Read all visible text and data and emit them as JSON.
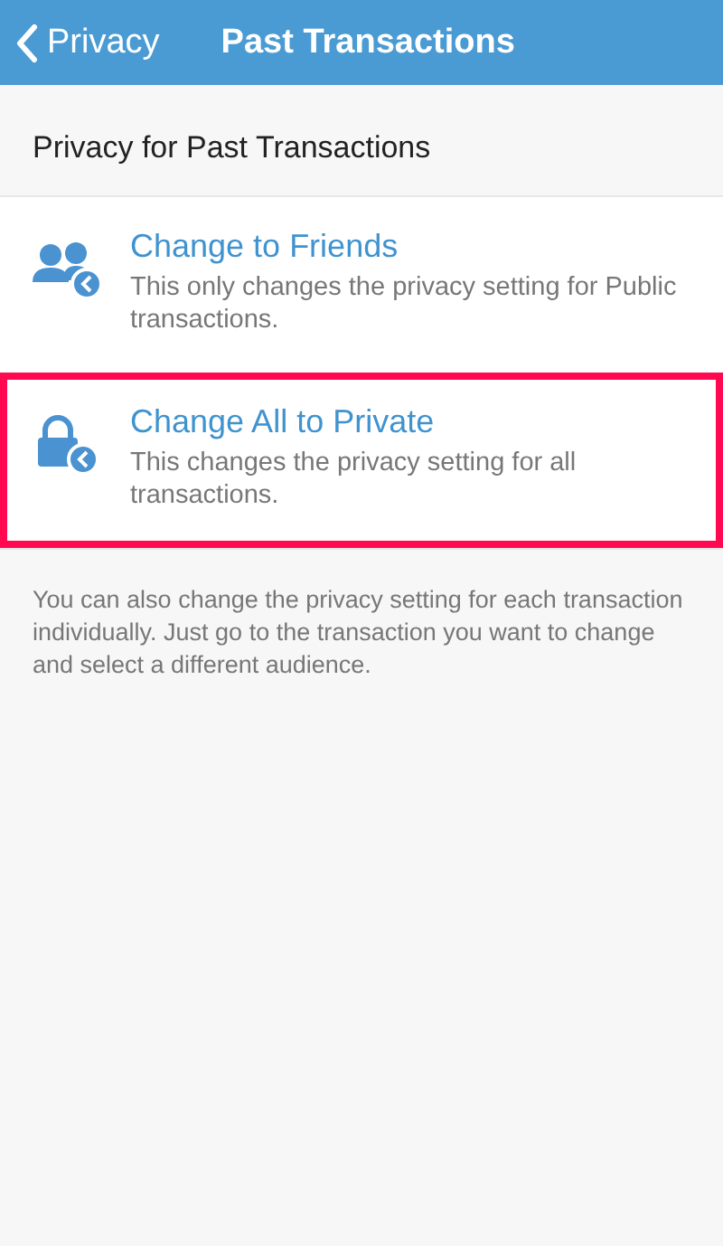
{
  "nav_bar": {
    "back_label": "Privacy",
    "title": "Past Transactions"
  },
  "section": {
    "title": "Privacy for Past Transactions"
  },
  "options": [
    {
      "kind": "friends",
      "title": "Change to Friends",
      "description": "This only changes the privacy setting for Public transactions.",
      "highlighted": false
    },
    {
      "kind": "private",
      "title": "Change All to Private",
      "description": "This changes the privacy setting for all transactions.",
      "highlighted": true
    }
  ],
  "footer_note": "You can also change the privacy setting for each transaction individually. Just go to the transaction you want to change and select a different audience."
}
